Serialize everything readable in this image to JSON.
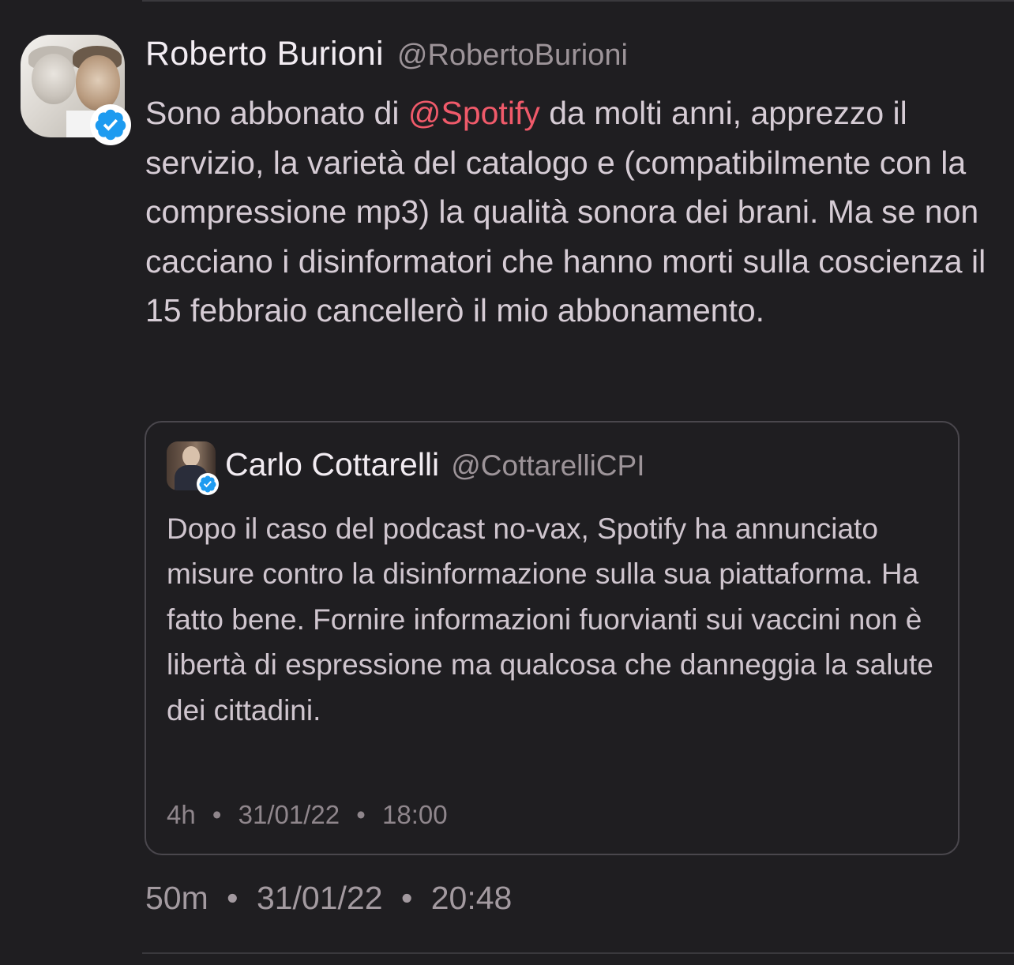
{
  "author": {
    "name": "Roberto Burioni",
    "handle": "@RobertoBurioni",
    "avatar_icon": "avatar-photo",
    "verified_icon": "verified-badge-icon"
  },
  "tweet": {
    "text_before": "Sono abbonato di ",
    "mention": "@Spotify",
    "text_after": "  da molti anni, apprezzo il servizio, la varietà del catalogo e (compatibilmente con la compressione mp3) la qualità sonora dei brani. Ma se non cacciano i disinformatori che hanno morti sulla coscienza il 15 febbraio cancellerò il mio abbonamento.",
    "mention_color": "#f05a6a",
    "meta": {
      "age": "50m",
      "date": "31/01/22",
      "time": "20:48",
      "separator": "•"
    }
  },
  "quoted": {
    "name": "Carlo Cottarelli",
    "handle": "@CottarelliCPI",
    "text": "Dopo il caso del podcast no-vax, Spotify ha annunciato misure contro la disinformazione sulla sua piattaforma. Ha fatto bene. Fornire informazioni fuorvianti sui vaccini non è libertà di espressione ma qualcosa che danneggia la salute dei cittadini.",
    "meta": {
      "age": "4h",
      "date": "31/01/22",
      "time": "18:00",
      "separator": "•"
    }
  },
  "colors": {
    "background": "#1f1e21",
    "verified": "#1d9bf0"
  }
}
